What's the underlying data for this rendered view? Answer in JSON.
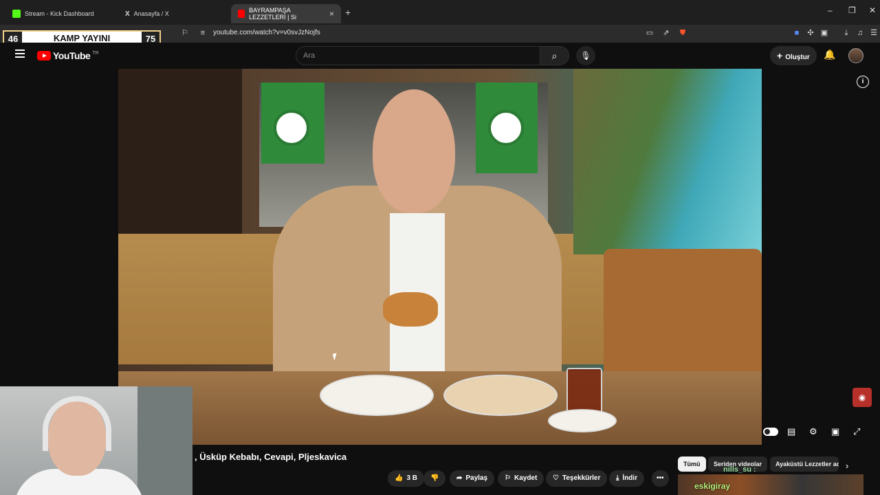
{
  "browser": {
    "tabs": [
      {
        "label": "Stream - Kick Dashboard",
        "icon": "kick-icon",
        "color": "#53fc18"
      },
      {
        "label": "Anasayfa / X",
        "icon": "x-icon",
        "color": "#ffffff"
      },
      {
        "label": "BAYRAMPAŞA LEZZETLERİ | Si",
        "icon": "youtube-icon",
        "color": "#ff0000"
      }
    ],
    "new_tab": "+",
    "url": "youtube.com/watch?v=v0svJzNojfs"
  },
  "overlay": {
    "left": "46",
    "label": "KAMP YAYINI",
    "right": "75",
    "border_color": "#f1d28a"
  },
  "youtube": {
    "logo_text": "YouTube",
    "country": "TR",
    "search_placeholder": "Ara",
    "create_label": "Oluştur",
    "brand_color": "#ff0000"
  },
  "video": {
    "title": ", Üsküp Kebabı, Cevapi, Pljeskavica"
  },
  "actions": {
    "like_count": "3 B",
    "share": "Paylaş",
    "save": "Kaydet",
    "thanks": "Teşekkürler",
    "download": "İndir",
    "more": "•••"
  },
  "chips": [
    {
      "label": "Tümü",
      "selected": true
    },
    {
      "label": "Seriden videolar",
      "selected": false
    },
    {
      "label": "Ayaküstü Lezzetler ad",
      "selected": false
    }
  ],
  "chat": {
    "line1": "nills_su :",
    "line2": "eskigiray"
  }
}
